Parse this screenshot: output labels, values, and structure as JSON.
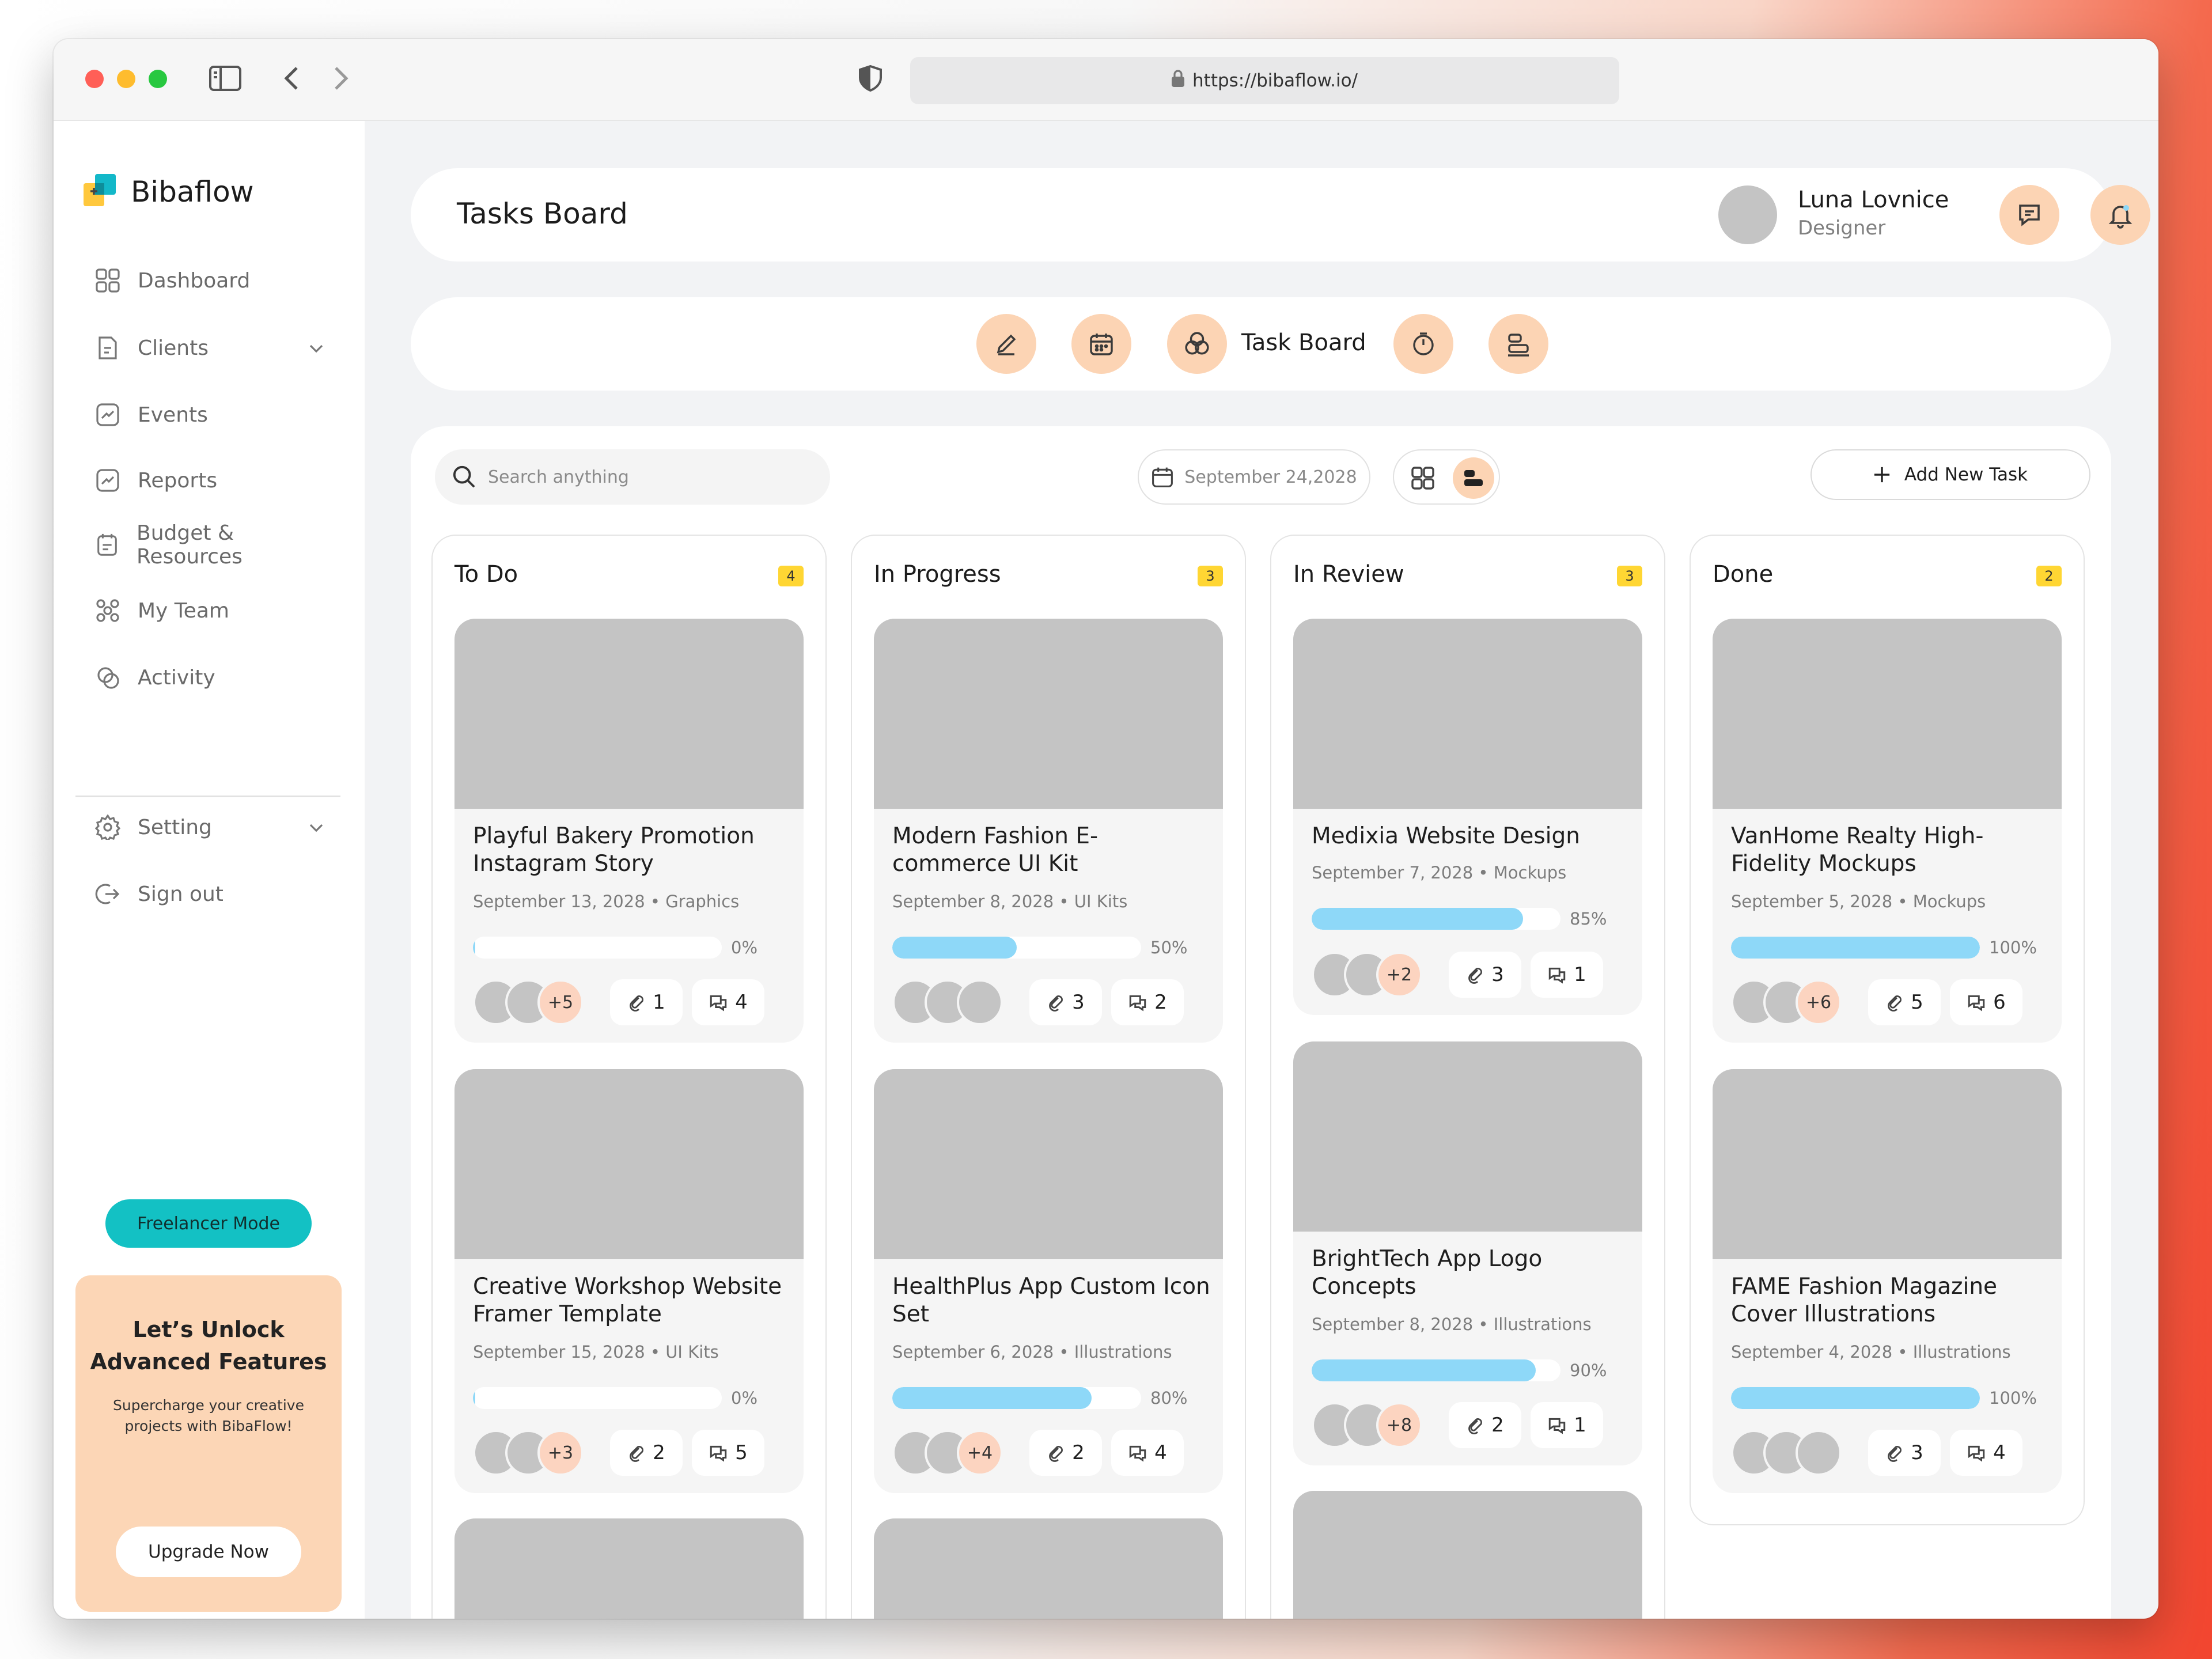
{
  "browser": {
    "url": "https://bibaflow.io/"
  },
  "brand": {
    "name": "Bibaflow"
  },
  "sidebar": {
    "items": [
      {
        "label": "Dashboard",
        "icon": "dashboard-icon"
      },
      {
        "label": "Clients",
        "icon": "clients-icon",
        "expandable": true
      },
      {
        "label": "Events",
        "icon": "events-icon"
      },
      {
        "label": "Reports",
        "icon": "reports-icon"
      },
      {
        "label": "Budget & Resources",
        "icon": "budget-icon"
      },
      {
        "label": "My Team",
        "icon": "team-icon"
      },
      {
        "label": "Activity",
        "icon": "activity-icon"
      }
    ],
    "bottom_items": [
      {
        "label": "Setting",
        "icon": "gear-icon",
        "expandable": true
      },
      {
        "label": "Sign out",
        "icon": "sign-out-icon"
      }
    ],
    "freelancer_mode": "Freelancer Mode",
    "promo": {
      "title_line1": "Let’s Unlock",
      "title_line2": "Advanced Features",
      "subtitle_line1": "Supercharge your creative",
      "subtitle_line2": "projects with BibaFlow!",
      "button": "Upgrade Now"
    }
  },
  "header": {
    "title": "Tasks Board",
    "user": {
      "name": "Luna Lovnice",
      "role": "Designer"
    }
  },
  "view_bar": {
    "active_label": "Task Board"
  },
  "toolbar": {
    "search_placeholder": "Search anything",
    "date": "September 24,2028",
    "add_task": "Add New Task"
  },
  "colors": {
    "accent": "#fcd4b4",
    "progress": "#8ed8f8",
    "count_badge": "#ffd633",
    "freelancer": "#13c1c4",
    "promo_bg": "#fcd6b6"
  },
  "columns": [
    {
      "title": "To Do",
      "count": "4",
      "cards": [
        {
          "title": "Playful Bakery Promotion Instagram Story",
          "date": "September 13, 2028",
          "category": "Graphics",
          "progress": 0,
          "progress_label": "0%",
          "extra": "+5",
          "links": "1",
          "comments": "4"
        },
        {
          "title": "Creative Workshop Website Framer Template",
          "date": "September 15, 2028",
          "category": "UI Kits",
          "progress": 0,
          "progress_label": "0%",
          "extra": "+3",
          "links": "2",
          "comments": "5"
        }
      ]
    },
    {
      "title": "In Progress",
      "count": "3",
      "cards": [
        {
          "title": "Modern Fashion E-commerce UI Kit",
          "date": "September 8, 2028",
          "category": "UI Kits",
          "progress": 50,
          "progress_label": "50%",
          "extra": "",
          "links": "3",
          "comments": "2"
        },
        {
          "title": "HealthPlus App Custom Icon Set",
          "date": "September 6, 2028",
          "category": "Illustrations",
          "progress": 80,
          "progress_label": "80%",
          "extra": "+4",
          "links": "2",
          "comments": "4"
        }
      ]
    },
    {
      "title": "In Review",
      "count": "3",
      "cards": [
        {
          "title": "Medixia Website Design",
          "date": "September 7, 2028",
          "category": "Mockups",
          "progress": 85,
          "progress_label": "85%",
          "extra": "+2",
          "links": "3",
          "comments": "1"
        },
        {
          "title": "BrightTech App Logo Concepts",
          "date": "September 8, 2028",
          "category": "Illustrations",
          "progress": 90,
          "progress_label": "90%",
          "extra": "+8",
          "links": "2",
          "comments": "1"
        }
      ]
    },
    {
      "title": "Done",
      "count": "2",
      "cards": [
        {
          "title": "VanHome Realty High-Fidelity Mockups",
          "date": "September 5, 2028",
          "category": "Mockups",
          "progress": 100,
          "progress_label": "100%",
          "extra": "+6",
          "links": "5",
          "comments": "6"
        },
        {
          "title": "FAME Fashion Magazine Cover Illustrations",
          "date": "September 4, 2028",
          "category": "Illustrations",
          "progress": 100,
          "progress_label": "100%",
          "extra": "",
          "links": "3",
          "comments": "4"
        }
      ]
    }
  ]
}
